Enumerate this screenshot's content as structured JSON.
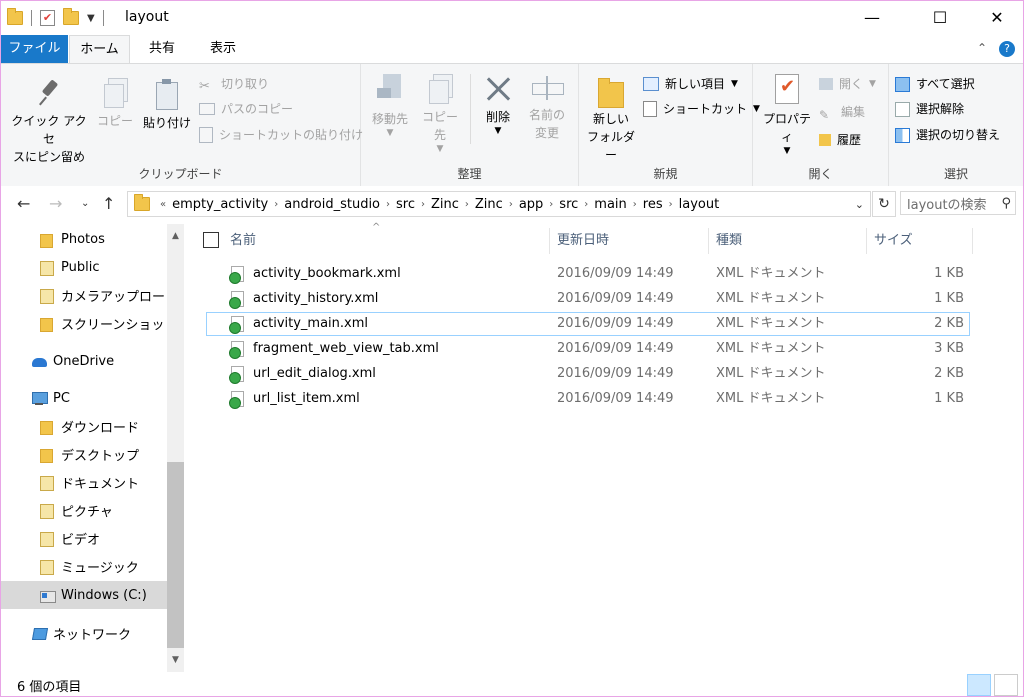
{
  "window": {
    "title": "layout",
    "controls": {
      "minimize": "—",
      "maximize": "☐",
      "close": "✕"
    }
  },
  "ribbon_tabs": [
    "ファイル",
    "ホーム",
    "共有",
    "表示"
  ],
  "ribbon": {
    "clipboard": {
      "label": "クリップボード",
      "pin_l1": "クイック アクセ",
      "pin_l2": "スにピン留め",
      "copy": "コピー",
      "paste": "貼り付け",
      "cut": "切り取り",
      "copy_path": "パスのコピー",
      "paste_shortcut": "ショートカットの貼り付け"
    },
    "organize": {
      "label": "整理",
      "move_to": "移動先",
      "copy_to": "コピー先",
      "delete": "削除",
      "rename_l1": "名前の",
      "rename_l2": "変更"
    },
    "new": {
      "label": "新規",
      "new_folder_l1": "新しい",
      "new_folder_l2": "フォルダー",
      "new_item": "新しい項目",
      "shortcut": "ショートカット"
    },
    "open": {
      "label": "開く",
      "properties": "プロパティ",
      "open": "開く",
      "edit": "編集",
      "history": "履歴"
    },
    "select": {
      "label": "選択",
      "select_all": "すべて選択",
      "select_none": "選択解除",
      "invert": "選択の切り替え"
    }
  },
  "address": {
    "breadcrumbs": [
      "empty_activity",
      "android_studio",
      "src",
      "Zinc",
      "Zinc",
      "app",
      "src",
      "main",
      "res",
      "layout"
    ],
    "overflow": "«",
    "search_placeholder": "layoutの検索"
  },
  "sidebar": {
    "items": [
      {
        "label": "Photos",
        "icon": "folder-icon"
      },
      {
        "label": "Public",
        "icon": "library-icon"
      },
      {
        "label": "カメラアップロード",
        "icon": "library-icon"
      },
      {
        "label": "スクリーンショット",
        "icon": "folder-icon"
      },
      {
        "label": "OneDrive",
        "icon": "cloud-icon"
      },
      {
        "label": "PC",
        "icon": "pc-icon"
      },
      {
        "label": "ダウンロード",
        "icon": "download-folder-icon"
      },
      {
        "label": "デスクトップ",
        "icon": "desktop-folder-icon"
      },
      {
        "label": "ドキュメント",
        "icon": "documents-folder-icon"
      },
      {
        "label": "ピクチャ",
        "icon": "pictures-folder-icon"
      },
      {
        "label": "ビデオ",
        "icon": "videos-folder-icon"
      },
      {
        "label": "ミュージック",
        "icon": "music-folder-icon"
      },
      {
        "label": "Windows (C:)",
        "icon": "drive-icon",
        "selected": true
      },
      {
        "label": "ネットワーク",
        "icon": "network-icon"
      }
    ]
  },
  "filelist": {
    "columns": [
      "名前",
      "更新日時",
      "種類",
      "サイズ"
    ],
    "rows": [
      {
        "name": "activity_bookmark.xml",
        "modified": "2016/09/09 14:49",
        "type": "XML ドキュメント",
        "size": "1 KB"
      },
      {
        "name": "activity_history.xml",
        "modified": "2016/09/09 14:49",
        "type": "XML ドキュメント",
        "size": "1 KB"
      },
      {
        "name": "activity_main.xml",
        "modified": "2016/09/09 14:49",
        "type": "XML ドキュメント",
        "size": "2 KB",
        "focused": true
      },
      {
        "name": "fragment_web_view_tab.xml",
        "modified": "2016/09/09 14:49",
        "type": "XML ドキュメント",
        "size": "3 KB"
      },
      {
        "name": "url_edit_dialog.xml",
        "modified": "2016/09/09 14:49",
        "type": "XML ドキュメント",
        "size": "2 KB"
      },
      {
        "name": "url_list_item.xml",
        "modified": "2016/09/09 14:49",
        "type": "XML ドキュメント",
        "size": "1 KB"
      }
    ]
  },
  "status": {
    "count": "6 個の項目"
  },
  "colors": {
    "accent": "#1979ca",
    "selection": "#cce8ff",
    "focus_border": "#99d1ff"
  }
}
